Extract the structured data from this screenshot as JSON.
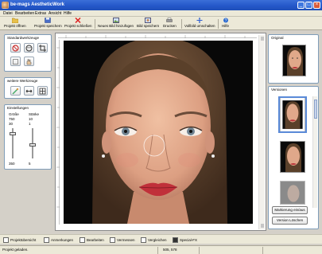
{
  "window": {
    "title": "be-mags AestheticWork"
  },
  "menu": [
    "Datei",
    "Bearbeiten",
    "Extras",
    "Ansicht",
    "Hilfe"
  ],
  "toolbar": {
    "open": "Projekt öffnen",
    "save": "Projekt speichern",
    "close": "Projekt schließen",
    "add_image": "Neues Bild hinzufügen",
    "save_image": "Bild speichern",
    "print": "Drucken",
    "fullscreen": "Vollbild umschalten",
    "help": "Hilfe"
  },
  "left": {
    "standard_tools": "Standardwerkzeuge",
    "more_tools": "weitere Werkzeuge",
    "settings": {
      "title": "Einstellungen",
      "size_label": "Größe",
      "strength_label": "Stärke",
      "size_max": "750",
      "size_value": "30",
      "size_min": "350",
      "strength_max": "10",
      "strength_value": "1",
      "strength_min": "5"
    }
  },
  "right": {
    "original_title": "Original",
    "versions_title": "Versionen",
    "mark_button": "Markierung ein/aus",
    "delete_button": "Version Löschen"
  },
  "tabs": [
    "Projektübersicht",
    "Anmerkungen",
    "Bearbeiten",
    "Vermessen",
    "Vergleichen",
    "Special-FX"
  ],
  "status": {
    "message": "Projekt geladen.",
    "coords": "505, 578"
  }
}
